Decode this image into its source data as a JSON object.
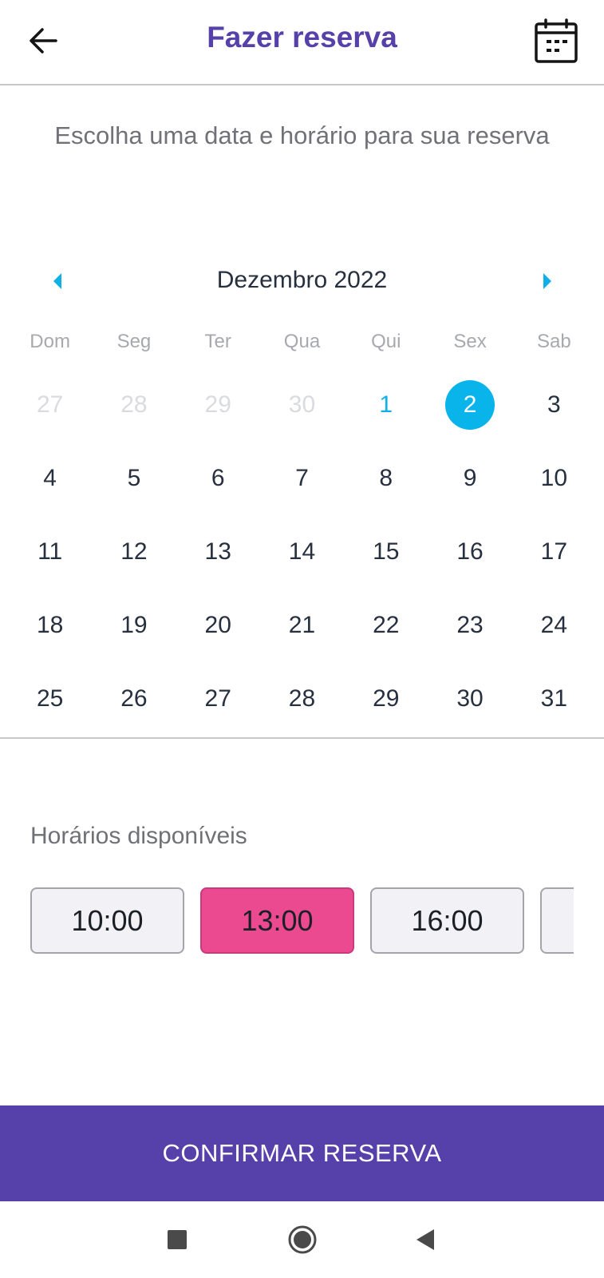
{
  "header": {
    "title": "Fazer reserva",
    "back_icon": "arrow-left-icon",
    "calendar_icon": "calendar-icon"
  },
  "subtitle": "Escolha uma data e horário para sua reserva",
  "calendar": {
    "month_label": "Dezembro 2022",
    "prev_icon": "caret-left-icon",
    "next_icon": "caret-right-icon",
    "accent_color": "#08b4ea",
    "weekdays": [
      "Dom",
      "Seg",
      "Ter",
      "Qua",
      "Qui",
      "Sex",
      "Sab"
    ],
    "weeks": [
      [
        "27",
        "28",
        "29",
        "30",
        "1",
        "2",
        "3"
      ],
      [
        "4",
        "5",
        "6",
        "7",
        "8",
        "9",
        "10"
      ],
      [
        "11",
        "12",
        "13",
        "14",
        "15",
        "16",
        "17"
      ],
      [
        "18",
        "19",
        "20",
        "21",
        "22",
        "23",
        "24"
      ],
      [
        "25",
        "26",
        "27",
        "28",
        "29",
        "30",
        "31"
      ]
    ],
    "outside_month_days": [
      "27",
      "28",
      "29",
      "30"
    ],
    "today": "1",
    "selected": "2"
  },
  "slots": {
    "title": "Horários disponíveis",
    "times": [
      "10:00",
      "13:00",
      "16:00",
      ""
    ],
    "selected": "13:00",
    "selected_color": "#ec4a90"
  },
  "confirm_label": "CONFIRMAR RESERVA",
  "brand_color": "#5641aa",
  "system_nav": {
    "recent_icon": "square-icon",
    "home_icon": "circle-icon",
    "back_icon": "triangle-back-icon"
  }
}
